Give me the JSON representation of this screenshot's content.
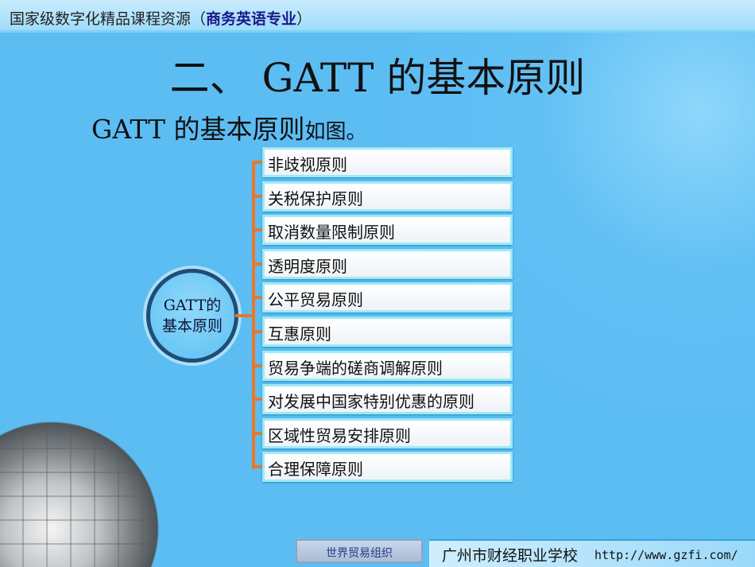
{
  "header": {
    "title": "国家级数字化精品课程资源",
    "open": "（",
    "subtitle": "商务英语专业",
    "close": "）"
  },
  "slide": {
    "title": "二、  GATT 的基本原则",
    "subtitle_main": "GATT 的基本原则",
    "subtitle_tail": "如图。"
  },
  "diagram": {
    "center": {
      "line1": "GATT的",
      "line2": "基本原则"
    },
    "items": [
      "非歧视原则",
      "关税保护原则",
      "取消数量限制原则",
      "透明度原则",
      "公平贸易原则",
      "互惠原则",
      "贸易争端的磋商调解原则",
      "对发展中国家特别优惠的原则",
      "区域性贸易安排原则",
      "合理保障原则"
    ],
    "connector_color": "#e8782a"
  },
  "footer": {
    "button": "世界贸易组织",
    "school": "广州市财经职业学校",
    "url": "http://www.gzfi.com/"
  }
}
